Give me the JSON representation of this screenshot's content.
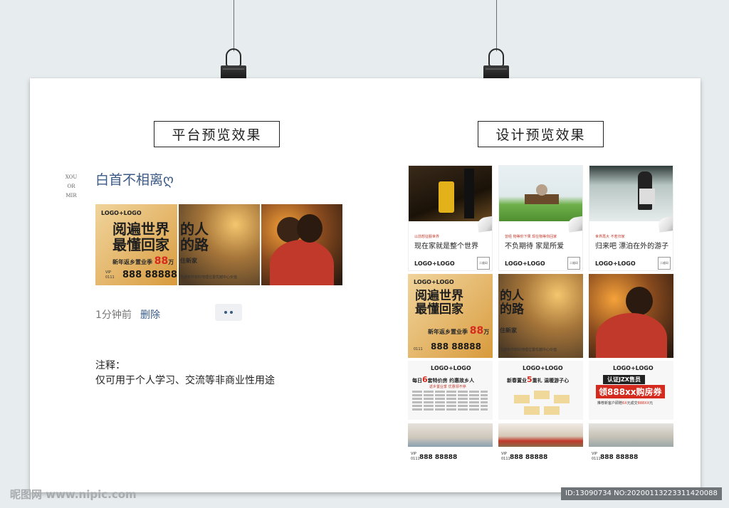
{
  "board": {
    "platform_title": "平台预览效果",
    "design_title": "设计预览效果"
  },
  "post": {
    "side_mark": [
      "XOU",
      "OR",
      "MIR"
    ],
    "username": "白首不相离ღ",
    "banner": {
      "logo": "LOGO+LOGO",
      "headline_line1": "阅遍世界",
      "headline_line2": "最懂回家",
      "headline2_line1": "的人",
      "headline2_line2": "的路",
      "subline_prefix": "新年返乡置业季",
      "price": "88",
      "price_unit": "万",
      "subline_suffix": "住新家",
      "vip_label": "VIP",
      "phone_prefix": "0111",
      "phone": "888 88888",
      "location_text": "交通条件较好地理位置优越中心价值"
    },
    "time": "1分钟前",
    "delete": "删除"
  },
  "note": {
    "title": "注释：",
    "text": "仅可用于个人学习、交流等非商业性用途"
  },
  "design": {
    "row1": [
      {
        "red": "以前想征服世界",
        "slogan": "现在家就是整个世界",
        "logo": "LOGO+LOGO",
        "qr": "二维码"
      },
      {
        "red": "曾经 物等你下果 现在物等你回家",
        "slogan": "不负期待 家是所爱",
        "logo": "LOGO+LOGO",
        "qr": "二维码"
      },
      {
        "red": "世界再大 不若归家",
        "slogan": "归来吧 漂泊在外的游子",
        "logo": "LOGO+LOGO",
        "qr": "二维码"
      }
    ],
    "row3": [
      {
        "logo": "LOGO+LOGO",
        "line1_prefix": "每日",
        "line1_num": "6",
        "line1_suffix": "套特价房 约惠故乡人",
        "line2": "返乡置业季 优惠领不停"
      },
      {
        "logo": "LOGO+LOGO",
        "line1_prefix": "新春置业",
        "line1_num": "5",
        "line1_suffix": "重礼 温暖游子心"
      },
      {
        "logo": "LOGO+LOGO",
        "badge": "认证JZX售员",
        "coupon": "领888xx购房券",
        "line2_prefix": "推荐新客户即赠",
        "line2_num": "6X",
        "line2_mid": "元成交",
        "line2_num2": "888XX",
        "line2_suffix": "元"
      }
    ],
    "row4": [
      {
        "vip": "VIP",
        "phone_prefix": "0111",
        "phone": "888 88888"
      },
      {
        "vip": "VIP",
        "phone_prefix": "0111",
        "phone": "888 88888"
      },
      {
        "vip": "VIP",
        "phone_prefix": "0111",
        "phone": "888 88888"
      }
    ]
  },
  "watermark": {
    "left": "昵图网 www.nipic.com",
    "right": "ID:13090734 NO:20200113223311420088"
  }
}
